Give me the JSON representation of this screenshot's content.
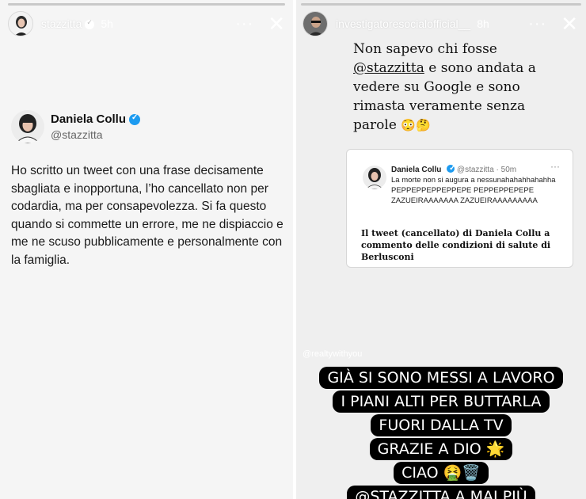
{
  "left_story": {
    "username": "stazzitta",
    "time": "5h",
    "more_label": "···",
    "close_label": "✕",
    "tweet": {
      "name": "Daniela Collu",
      "handle": "@stazzitta",
      "text": "Ho scritto un tweet con una frase decisamente sbagliata e inopportuna, l’ho cancellato non per codardia, ma per consapevolezza. Si fa questo quando si commette un errore, me ne dispiaccio e me ne scuso pubblicamente e personalmente con la famiglia."
    }
  },
  "right_story": {
    "username": "investigatoresocialofficial__",
    "time": "8h",
    "more_label": "···",
    "close_label": "✕",
    "quote": {
      "line1": "Non sapevo chi fosse",
      "mention": "@stazzitta",
      "line2": "e sono andata a vedere su Google e sono rimasta veramente senza parole",
      "emoji": "😳🤔"
    },
    "embedded_tweet": {
      "name": "Daniela Collu",
      "handle_time": "@stazzitta · 50m",
      "dots": "···",
      "text": "La morte non si augura a nessunahahahhahahha PEPPEPPEPPEPPEPE PEPPEPPEPEPE ZAZUEIRAAAAAAA ZAZUEIRAAAAAAAAA",
      "caption": "Il tweet (cancellato) di Daniela Collu a commento delle condizioni di salute di Berlusconi"
    },
    "watermark": "@realtywithyou",
    "caption_lines": [
      "GIÀ SI SONO MESSI A LAVORO",
      "I PIANI ALTI PER BUTTARLA",
      "FUORI DALLA TV",
      "GRAZIE A DIO 🌟",
      "CIAO 🤮🗑️"
    ],
    "caption_last_mention": "@STAZZITTA",
    "caption_last_rest": " A MAI PIÙ"
  },
  "colors": {
    "verified_blue": "#1d9bf0",
    "pill_bg": "#000000",
    "story_bg": "#f5f5f5"
  }
}
